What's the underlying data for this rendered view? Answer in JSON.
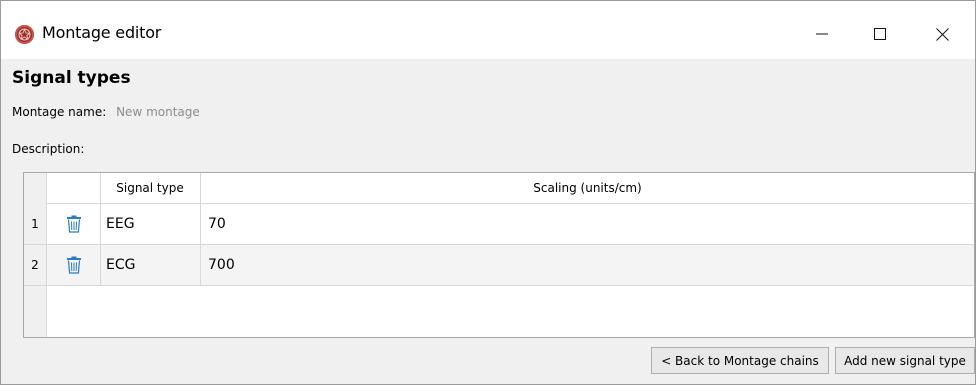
{
  "window": {
    "title": "Montage editor"
  },
  "heading": "Signal types",
  "montage_name": {
    "label": "Montage name:",
    "value": "New montage"
  },
  "description": {
    "label": "Description:"
  },
  "table": {
    "columns": [
      "",
      "Signal type",
      "Scaling (units/cm)"
    ],
    "rows": [
      {
        "num": "1",
        "type": "EEG",
        "scaling": "70"
      },
      {
        "num": "2",
        "type": "ECG",
        "scaling": "700"
      }
    ]
  },
  "buttons": {
    "back": "< Back to Montage chains",
    "add": "Add new signal type"
  },
  "icons": {
    "app": "app-logo-icon",
    "minimize": "minimize-icon",
    "maximize": "maximize-icon",
    "close": "close-icon",
    "delete": "trash-icon"
  },
  "colors": {
    "trash": "#2b7cc4",
    "app_icon": "#9b2e2b"
  }
}
